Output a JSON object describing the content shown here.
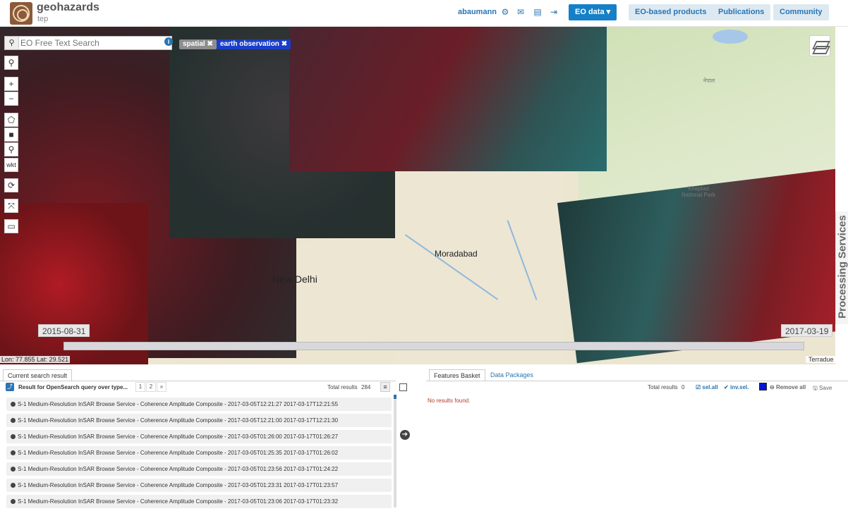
{
  "header": {
    "brand": "geohazards",
    "brand_sub": "tep",
    "user": "abaumann",
    "nav": {
      "eo_data": "EO data ▾",
      "eo_products": "EO-based products",
      "publications": "Publications",
      "community": "Community"
    },
    "accent_color": "#1580c7"
  },
  "search": {
    "placeholder": "EO Free Text Search",
    "tags": [
      "spatial ✖",
      "earth observation ✖"
    ]
  },
  "map": {
    "cities": [
      "New Delhi",
      "Moradabad"
    ],
    "park": "Khaptad National Park",
    "script_label": "नेपाल",
    "tools": [
      "⚲",
      "+",
      "−",
      "⬠",
      "■",
      "⚲",
      "wkt",
      "⟳",
      "⤧",
      "▭"
    ],
    "timeline": {
      "start": "2015-08-31",
      "end": "2017-03-19"
    },
    "coords": "Lon: 77.855  Lat: 29.521",
    "attribution": "Terradue",
    "side_tab": "Processing Services"
  },
  "results": {
    "tab": "Current search result",
    "title": "Result for OpenSearch query over type...",
    "pages": [
      "1",
      "2",
      "»"
    ],
    "total_label": "Total results",
    "total": "284",
    "items": [
      "S-1 Medium-Resolution InSAR Browse Service - Coherence Amplitude Composite - 2017-03-05T12:21:27 2017-03-17T12:21:55",
      "S-1 Medium-Resolution InSAR Browse Service - Coherence Amplitude Composite - 2017-03-05T12:21:00 2017-03-17T12:21:30",
      "S-1 Medium-Resolution InSAR Browse Service - Coherence Amplitude Composite - 2017-03-05T01:26:00 2017-03-17T01:26:27",
      "S-1 Medium-Resolution InSAR Browse Service - Coherence Amplitude Composite - 2017-03-05T01:25:35 2017-03-17T01:26:02",
      "S-1 Medium-Resolution InSAR Browse Service - Coherence Amplitude Composite - 2017-03-05T01:23:56 2017-03-17T01:24:22",
      "S-1 Medium-Resolution InSAR Browse Service - Coherence Amplitude Composite - 2017-03-05T01:23:31 2017-03-17T01:23:57",
      "S-1 Medium-Resolution InSAR Browse Service - Coherence Amplitude Composite - 2017-03-05T01:23:06 2017-03-17T01:23:32"
    ]
  },
  "basket": {
    "tab": "Features Basket",
    "tab2": "Data Packages",
    "total_label": "Total results",
    "total": "0",
    "sel_all": "sel.all",
    "inv_sel": "inv.sel.",
    "remove_all": "Remove all",
    "save": "Save",
    "no_results": "No results found.",
    "color": "#0015d9"
  }
}
